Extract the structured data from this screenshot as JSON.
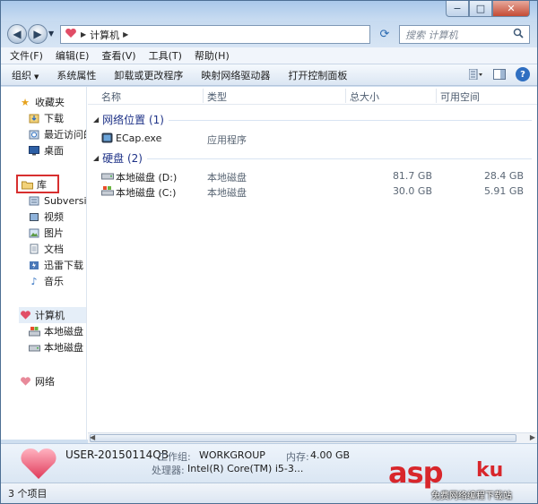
{
  "window": {
    "caption_buttons": {
      "minimize": "−",
      "maximize": "□",
      "close": "✕"
    }
  },
  "nav": {
    "back_icon": "back-arrow-icon",
    "forward_icon": "forward-arrow-icon",
    "address": {
      "icon": "computer-icon",
      "crumb": "计算机"
    },
    "search_placeholder": "搜索 计算机"
  },
  "menu": {
    "items": [
      "文件(F)",
      "编辑(E)",
      "查看(V)",
      "工具(T)",
      "帮助(H)"
    ]
  },
  "commands": {
    "organize": "组织",
    "system_properties": "系统属性",
    "uninstall": "卸载或更改程序",
    "map_drive": "映射网络驱动器",
    "control_panel": "打开控制面板"
  },
  "sidebar": {
    "favorites": "收藏夹",
    "downloads": "下载",
    "recent": "最近访问的",
    "desktop": "桌面",
    "library": "库",
    "subversion": "Subversion",
    "videos": "视频",
    "pictures": "图片",
    "documents": "文档",
    "thunder": "迅雷下载",
    "music": "音乐",
    "computer": "计算机",
    "disk_c": "本地磁盘 (C",
    "disk_d": "本地磁盘 (D",
    "network": "网络"
  },
  "columns": {
    "name": "名称",
    "type": "类型",
    "total": "总大小",
    "free": "可用空间"
  },
  "groups": {
    "network": {
      "title": "网络位置 (1)",
      "items": [
        {
          "name": "ECap.exe",
          "type": "应用程序"
        }
      ]
    },
    "disks": {
      "title": "硬盘 (2)",
      "items": [
        {
          "name": "本地磁盘 (D:)",
          "type": "本地磁盘",
          "total": "81.7 GB",
          "free": "28.4 GB"
        },
        {
          "name": "本地磁盘 (C:)",
          "type": "本地磁盘",
          "total": "30.0 GB",
          "free": "5.91 GB"
        }
      ]
    }
  },
  "details": {
    "computer_name": "USER-20150114QB",
    "workgroup_label": "工作组:",
    "workgroup_value": "WORKGROUP",
    "memory_label": "内存:",
    "memory_value": "4.00 GB",
    "cpu_label": "处理器:",
    "cpu_value": "Intel(R) Core(TM) i5-3..."
  },
  "status": {
    "count": "3 个项目"
  },
  "watermark": {
    "brand": "asp",
    "brand2": "ku",
    "sub": "免费网络编程下载站"
  },
  "colors": {
    "accent": "#1e3287",
    "highlight_box": "#d72f2f",
    "brand_red": "#d8262b"
  }
}
